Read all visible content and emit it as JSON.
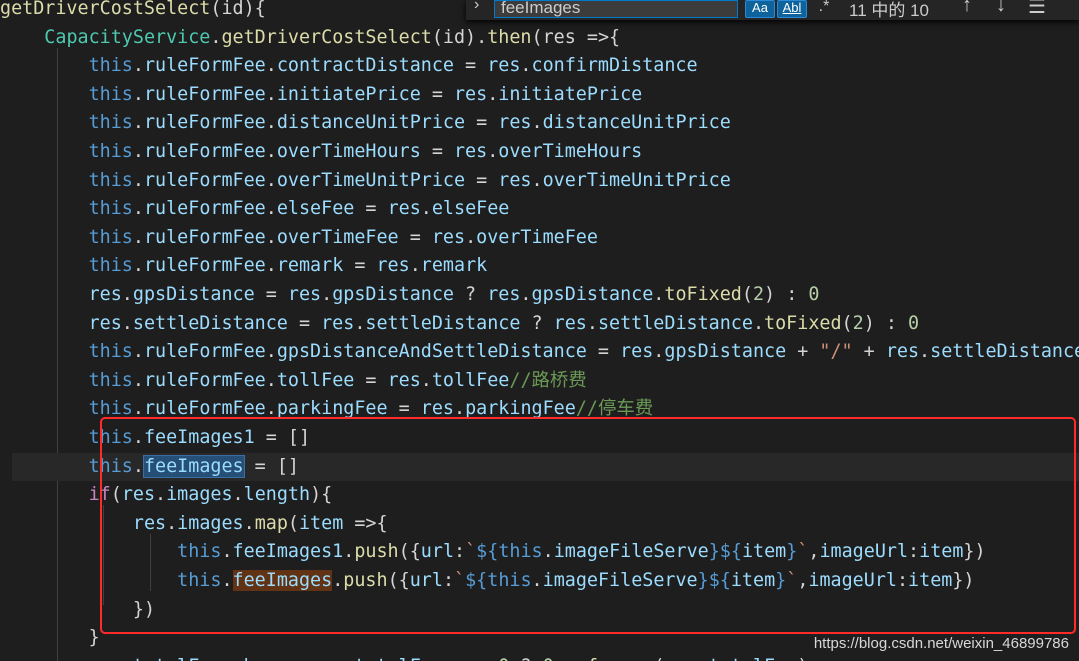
{
  "find": {
    "query": "feeImages",
    "case_label": "Aa",
    "word_label": "Abl",
    "regex_label": ".*",
    "match_count": "11 中的 10",
    "prev_label": "↑",
    "next_label": "↓",
    "menu_label": "☰",
    "toggle_label": "›"
  },
  "watermark": "https://blog.csdn.net/weixin_46899786",
  "code_lines": [
    [
      [
        "fn",
        "getDriverCostSelect"
      ],
      [
        "op",
        "(id){"
      ]
    ],
    [
      [
        "op",
        "    "
      ],
      [
        "cls",
        "CapacityService"
      ],
      [
        "op",
        "."
      ],
      [
        "fn",
        "getDriverCostSelect"
      ],
      [
        "op",
        "(id)."
      ],
      [
        "fn",
        "then"
      ],
      [
        "op",
        "(res =>{"
      ]
    ],
    [
      [
        "op",
        "        "
      ],
      [
        "this",
        "this"
      ],
      [
        "op",
        "."
      ],
      [
        "prop",
        "ruleFormFee"
      ],
      [
        "op",
        "."
      ],
      [
        "prop",
        "contractDistance"
      ],
      [
        "op",
        " = "
      ],
      [
        "prop",
        "res"
      ],
      [
        "op",
        "."
      ],
      [
        "prop",
        "confirmDistance"
      ]
    ],
    [
      [
        "op",
        "        "
      ],
      [
        "this",
        "this"
      ],
      [
        "op",
        "."
      ],
      [
        "prop",
        "ruleFormFee"
      ],
      [
        "op",
        "."
      ],
      [
        "prop",
        "initiatePrice"
      ],
      [
        "op",
        " = "
      ],
      [
        "prop",
        "res"
      ],
      [
        "op",
        "."
      ],
      [
        "prop",
        "initiatePrice"
      ]
    ],
    [
      [
        "op",
        "        "
      ],
      [
        "this",
        "this"
      ],
      [
        "op",
        "."
      ],
      [
        "prop",
        "ruleFormFee"
      ],
      [
        "op",
        "."
      ],
      [
        "prop",
        "distanceUnitPrice"
      ],
      [
        "op",
        " = "
      ],
      [
        "prop",
        "res"
      ],
      [
        "op",
        "."
      ],
      [
        "prop",
        "distanceUnitPrice"
      ]
    ],
    [
      [
        "op",
        "        "
      ],
      [
        "this",
        "this"
      ],
      [
        "op",
        "."
      ],
      [
        "prop",
        "ruleFormFee"
      ],
      [
        "op",
        "."
      ],
      [
        "prop",
        "overTimeHours"
      ],
      [
        "op",
        " = "
      ],
      [
        "prop",
        "res"
      ],
      [
        "op",
        "."
      ],
      [
        "prop",
        "overTimeHours"
      ]
    ],
    [
      [
        "op",
        "        "
      ],
      [
        "this",
        "this"
      ],
      [
        "op",
        "."
      ],
      [
        "prop",
        "ruleFormFee"
      ],
      [
        "op",
        "."
      ],
      [
        "prop",
        "overTimeUnitPrice"
      ],
      [
        "op",
        " = "
      ],
      [
        "prop",
        "res"
      ],
      [
        "op",
        "."
      ],
      [
        "prop",
        "overTimeUnitPrice"
      ]
    ],
    [
      [
        "op",
        "        "
      ],
      [
        "this",
        "this"
      ],
      [
        "op",
        "."
      ],
      [
        "prop",
        "ruleFormFee"
      ],
      [
        "op",
        "."
      ],
      [
        "prop",
        "elseFee"
      ],
      [
        "op",
        " = "
      ],
      [
        "prop",
        "res"
      ],
      [
        "op",
        "."
      ],
      [
        "prop",
        "elseFee"
      ]
    ],
    [
      [
        "op",
        "        "
      ],
      [
        "this",
        "this"
      ],
      [
        "op",
        "."
      ],
      [
        "prop",
        "ruleFormFee"
      ],
      [
        "op",
        "."
      ],
      [
        "prop",
        "overTimeFee"
      ],
      [
        "op",
        " = "
      ],
      [
        "prop",
        "res"
      ],
      [
        "op",
        "."
      ],
      [
        "prop",
        "overTimeFee"
      ]
    ],
    [
      [
        "op",
        "        "
      ],
      [
        "this",
        "this"
      ],
      [
        "op",
        "."
      ],
      [
        "prop",
        "ruleFormFee"
      ],
      [
        "op",
        "."
      ],
      [
        "prop",
        "remark"
      ],
      [
        "op",
        " = "
      ],
      [
        "prop",
        "res"
      ],
      [
        "op",
        "."
      ],
      [
        "prop",
        "remark"
      ]
    ],
    [
      [
        "op",
        "        "
      ],
      [
        "prop",
        "res"
      ],
      [
        "op",
        "."
      ],
      [
        "prop",
        "gpsDistance"
      ],
      [
        "op",
        " = "
      ],
      [
        "prop",
        "res"
      ],
      [
        "op",
        "."
      ],
      [
        "prop",
        "gpsDistance"
      ],
      [
        "op",
        " ? "
      ],
      [
        "prop",
        "res"
      ],
      [
        "op",
        "."
      ],
      [
        "prop",
        "gpsDistance"
      ],
      [
        "op",
        "."
      ],
      [
        "fn",
        "toFixed"
      ],
      [
        "op",
        "("
      ],
      [
        "num",
        "2"
      ],
      [
        "op",
        ") : "
      ],
      [
        "num",
        "0"
      ]
    ],
    [
      [
        "op",
        "        "
      ],
      [
        "prop",
        "res"
      ],
      [
        "op",
        "."
      ],
      [
        "prop",
        "settleDistance"
      ],
      [
        "op",
        " = "
      ],
      [
        "prop",
        "res"
      ],
      [
        "op",
        "."
      ],
      [
        "prop",
        "settleDistance"
      ],
      [
        "op",
        " ? "
      ],
      [
        "prop",
        "res"
      ],
      [
        "op",
        "."
      ],
      [
        "prop",
        "settleDistance"
      ],
      [
        "op",
        "."
      ],
      [
        "fn",
        "toFixed"
      ],
      [
        "op",
        "("
      ],
      [
        "num",
        "2"
      ],
      [
        "op",
        ") : "
      ],
      [
        "num",
        "0"
      ]
    ],
    [
      [
        "op",
        "        "
      ],
      [
        "this",
        "this"
      ],
      [
        "op",
        "."
      ],
      [
        "prop",
        "ruleFormFee"
      ],
      [
        "op",
        "."
      ],
      [
        "prop",
        "gpsDistanceAndSettleDistance"
      ],
      [
        "op",
        " = "
      ],
      [
        "prop",
        "res"
      ],
      [
        "op",
        "."
      ],
      [
        "prop",
        "gpsDistance"
      ],
      [
        "op",
        " + "
      ],
      [
        "str",
        "\"/\""
      ],
      [
        "op",
        " + "
      ],
      [
        "prop",
        "res"
      ],
      [
        "op",
        "."
      ],
      [
        "prop",
        "settleDistance"
      ]
    ],
    [
      [
        "op",
        "        "
      ],
      [
        "this",
        "this"
      ],
      [
        "op",
        "."
      ],
      [
        "prop",
        "ruleFormFee"
      ],
      [
        "op",
        "."
      ],
      [
        "prop",
        "tollFee"
      ],
      [
        "op",
        " = "
      ],
      [
        "prop",
        "res"
      ],
      [
        "op",
        "."
      ],
      [
        "prop",
        "tollFee"
      ],
      [
        "cmt",
        "//路桥费"
      ]
    ],
    [
      [
        "op",
        "        "
      ],
      [
        "this",
        "this"
      ],
      [
        "op",
        "."
      ],
      [
        "prop",
        "ruleFormFee"
      ],
      [
        "op",
        "."
      ],
      [
        "prop",
        "parkingFee"
      ],
      [
        "op",
        " = "
      ],
      [
        "prop",
        "res"
      ],
      [
        "op",
        "."
      ],
      [
        "prop",
        "parkingFee"
      ],
      [
        "cmt",
        "//停车费"
      ]
    ],
    [
      [
        "op",
        "        "
      ],
      [
        "this",
        "this"
      ],
      [
        "op",
        "."
      ],
      [
        "prop",
        "feeImages1"
      ],
      [
        "op",
        " = []"
      ]
    ],
    [
      [
        "op",
        "        "
      ],
      [
        "this",
        "this"
      ],
      [
        "op",
        "."
      ],
      [
        "match",
        "feeImages"
      ],
      [
        "op",
        " = []"
      ]
    ],
    [
      [
        "op",
        "        "
      ],
      [
        "kw",
        "if"
      ],
      [
        "op",
        "("
      ],
      [
        "prop",
        "res"
      ],
      [
        "op",
        "."
      ],
      [
        "prop",
        "images"
      ],
      [
        "op",
        "."
      ],
      [
        "prop",
        "length"
      ],
      [
        "op",
        "){"
      ]
    ],
    [
      [
        "op",
        "            "
      ],
      [
        "prop",
        "res"
      ],
      [
        "op",
        "."
      ],
      [
        "prop",
        "images"
      ],
      [
        "op",
        "."
      ],
      [
        "fn",
        "map"
      ],
      [
        "op",
        "("
      ],
      [
        "prop",
        "item"
      ],
      [
        "op",
        " =>{"
      ]
    ],
    [
      [
        "op",
        "                "
      ],
      [
        "this",
        "this"
      ],
      [
        "op",
        "."
      ],
      [
        "prop",
        "feeImages1"
      ],
      [
        "op",
        "."
      ],
      [
        "fn",
        "push"
      ],
      [
        "op",
        "({"
      ],
      [
        "prop",
        "url"
      ],
      [
        "op",
        ":"
      ],
      [
        "str",
        "`"
      ],
      [
        "tpl",
        "${"
      ],
      [
        "this",
        "this"
      ],
      [
        "op",
        "."
      ],
      [
        "prop",
        "imageFileServe"
      ],
      [
        "tpl",
        "}${"
      ],
      [
        "prop",
        "item"
      ],
      [
        "tpl",
        "}"
      ],
      [
        "str",
        "`"
      ],
      [
        "op",
        ","
      ],
      [
        "prop",
        "imageUrl"
      ],
      [
        "op",
        ":"
      ],
      [
        "prop",
        "item"
      ],
      [
        "op",
        "})"
      ]
    ],
    [
      [
        "op",
        "                "
      ],
      [
        "this",
        "this"
      ],
      [
        "op",
        "."
      ],
      [
        "other",
        "feeImages"
      ],
      [
        "op",
        "."
      ],
      [
        "fn",
        "push"
      ],
      [
        "op",
        "({"
      ],
      [
        "prop",
        "url"
      ],
      [
        "op",
        ":"
      ],
      [
        "str",
        "`"
      ],
      [
        "tpl",
        "${"
      ],
      [
        "this",
        "this"
      ],
      [
        "op",
        "."
      ],
      [
        "prop",
        "imageFileServe"
      ],
      [
        "tpl",
        "}${"
      ],
      [
        "prop",
        "item"
      ],
      [
        "tpl",
        "}"
      ],
      [
        "str",
        "`"
      ],
      [
        "op",
        ","
      ],
      [
        "prop",
        "imageUrl"
      ],
      [
        "op",
        ":"
      ],
      [
        "prop",
        "item"
      ],
      [
        "op",
        "})"
      ]
    ],
    [
      [
        "op",
        "            "
      ],
      [
        "op",
        "})"
      ]
    ],
    [
      [
        "op",
        "        "
      ],
      [
        "op",
        "}"
      ]
    ],
    [
      [
        "op",
        "        "
      ],
      [
        "prop",
        "res"
      ],
      [
        "op",
        "."
      ],
      [
        "prop",
        "totalFee_show"
      ],
      [
        "op",
        " = "
      ],
      [
        "prop",
        "res"
      ],
      [
        "op",
        "."
      ],
      [
        "prop",
        "totalFee"
      ],
      [
        "op",
        " === "
      ],
      [
        "num",
        "0"
      ],
      [
        "op",
        " ? "
      ],
      [
        "num",
        "0"
      ],
      [
        "op",
        " : "
      ],
      [
        "fn",
        "fmoney"
      ],
      [
        "op",
        "("
      ],
      [
        "prop",
        "res"
      ],
      [
        "op",
        "."
      ],
      [
        "prop",
        "totalFee"
      ],
      [
        "op",
        ")"
      ]
    ]
  ]
}
